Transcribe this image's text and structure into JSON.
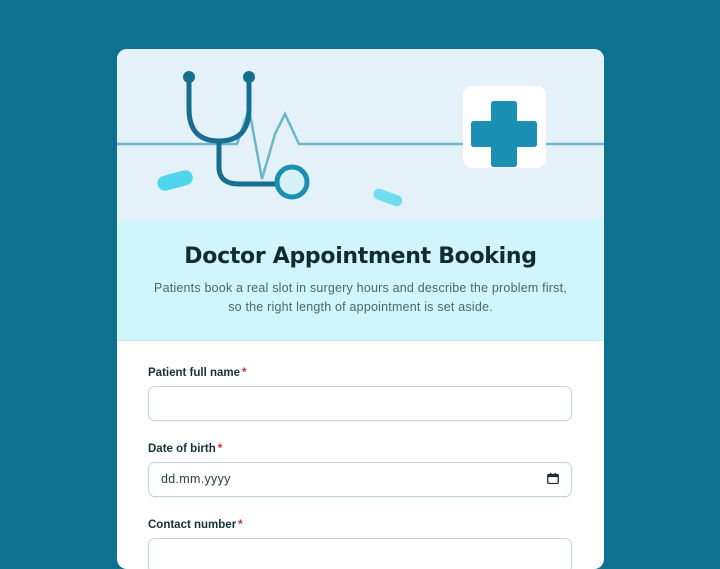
{
  "header": {
    "title": "Doctor Appointment Booking",
    "subtitle": "Patients book a real slot in surgery hours and describe the problem first, so the right length of appointment is set aside."
  },
  "form": {
    "fields": [
      {
        "label": "Patient full name",
        "required_mark": "*",
        "value": "",
        "placeholder": ""
      },
      {
        "label": "Date of birth",
        "required_mark": "*",
        "placeholder": "dd.mm.yyyy",
        "icon": "calendar-icon"
      },
      {
        "label": "Contact number",
        "required_mark": "*",
        "value": ""
      }
    ]
  },
  "colors": {
    "page_background": "#0f7190",
    "hero_background": "#e4f1f8",
    "intro_background": "#d0f6fb",
    "accent": "#1a8fb0",
    "required": "#d42a2a"
  },
  "illustration": {
    "icons": [
      "stethoscope-icon",
      "medical-cross-icon",
      "pill-icon",
      "heartbeat-line-icon"
    ]
  }
}
